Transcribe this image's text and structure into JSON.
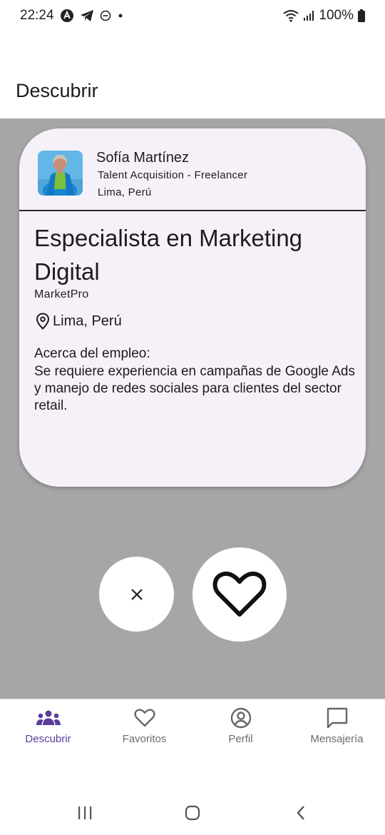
{
  "status_bar": {
    "time": "22:24",
    "battery": "100%"
  },
  "app_bar": {
    "title": "Descubrir"
  },
  "card": {
    "poster": {
      "name": "Sofía Martínez",
      "role": "Talent Acquisition - Freelancer",
      "location": "Lima, Perú"
    },
    "job": {
      "title": "Especialista en Marketing Digital",
      "company": "MarketPro",
      "location": "Lima, Perú",
      "about_label": "Acerca del empleo:",
      "about_text": "Se requiere experiencia en campañas de Google Ads y manejo de redes sociales para clientes del sector retail."
    }
  },
  "actions": {
    "reject_icon": "close-icon",
    "like_icon": "heart-icon"
  },
  "bottom_nav": {
    "items": [
      {
        "label": "Descubrir",
        "icon": "people-icon",
        "active": true
      },
      {
        "label": "Favoritos",
        "icon": "heart-outline-icon",
        "active": false
      },
      {
        "label": "Perfil",
        "icon": "account-circle-icon",
        "active": false
      },
      {
        "label": "Mensajería",
        "icon": "chat-icon",
        "active": false
      }
    ]
  },
  "colors": {
    "accent": "#5a3e9a",
    "card_bg": "#f6f1f8",
    "backdrop": "#a6a6a6"
  }
}
